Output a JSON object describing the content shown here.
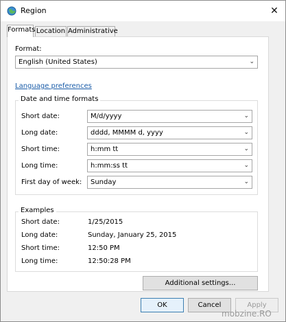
{
  "window": {
    "title": "Region",
    "close_glyph": "✕"
  },
  "tabs": [
    {
      "label": "Formats",
      "active": true
    },
    {
      "label": "Location",
      "active": false
    },
    {
      "label": "Administrative",
      "active": false
    }
  ],
  "format": {
    "label": "Format:",
    "value": "English (United States)"
  },
  "language_link": "Language preferences",
  "date_time_group": {
    "title": "Date and time formats",
    "short_date": {
      "label": "Short date:",
      "value": "M/d/yyyy"
    },
    "long_date": {
      "label": "Long date:",
      "value": "dddd, MMMM d, yyyy"
    },
    "short_time": {
      "label": "Short time:",
      "value": "h:mm tt"
    },
    "long_time": {
      "label": "Long time:",
      "value": "h:mm:ss tt"
    },
    "first_day": {
      "label": "First day of week:",
      "value": "Sunday"
    }
  },
  "examples_group": {
    "title": "Examples",
    "short_date": {
      "label": "Short date:",
      "value": "1/25/2015"
    },
    "long_date": {
      "label": "Long date:",
      "value": "Sunday, January 25, 2015"
    },
    "short_time": {
      "label": "Short time:",
      "value": "12:50 PM"
    },
    "long_time": {
      "label": "Long time:",
      "value": "12:50:28 PM"
    }
  },
  "buttons": {
    "additional": "Additional settings...",
    "ok": "OK",
    "cancel": "Cancel",
    "apply": "Apply"
  },
  "chevron_glyph": "⌄",
  "watermark": "mobzine.RO",
  "icons": {
    "app": "region-globe-icon",
    "close": "close-icon",
    "dropdown": "chevron-down-icon"
  }
}
